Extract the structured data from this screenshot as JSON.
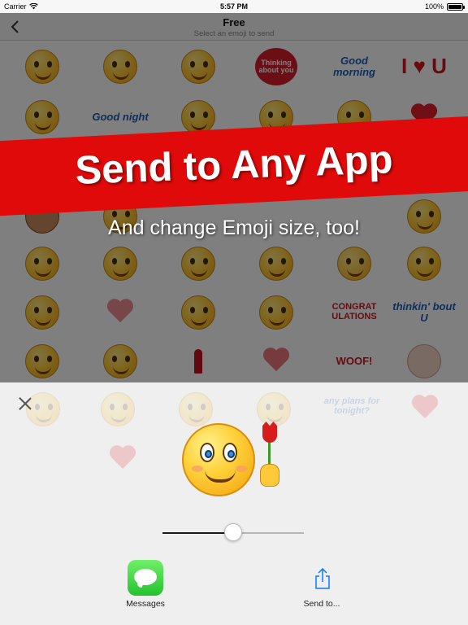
{
  "status_bar": {
    "carrier": "Carrier",
    "time": "5:57 PM",
    "battery": "100%",
    "battery_level": 1.0
  },
  "nav": {
    "title": "Free",
    "subtitle": "Select an emoji to send"
  },
  "grid_text": {
    "thinking": "Thinking about you",
    "good_morning": "Good morning",
    "i_love_u": "I ♥ U",
    "good_night": "Good night",
    "congratulations": "CONGRAT ULATIONS",
    "thinkin_bout_u": "thinkin' bout U",
    "woof": "WOOF!",
    "any_plans": "any plans for tonight?"
  },
  "promo": {
    "headline": "Send to Any App",
    "tagline": "And change Emoji size, too!"
  },
  "size_slider": {
    "value": 0.5
  },
  "actions": {
    "messages_label": "Messages",
    "send_to_label": "Send to..."
  },
  "colors": {
    "banner_red": "#e10a0a",
    "messages_green": "#2ecc40",
    "ios_blue": "#0a84ff"
  }
}
